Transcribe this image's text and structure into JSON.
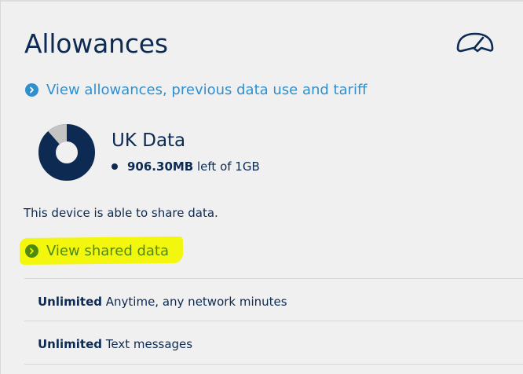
{
  "page": {
    "title": "Allowances",
    "gauge_icon": "speedometer-icon"
  },
  "links": {
    "allowances": "View allowances, previous data use and tariff",
    "shared": "View shared data"
  },
  "data_allowance": {
    "title": "UK Data",
    "remaining_strong": "906.30MB",
    "remaining_rest": " left of 1GB",
    "used_fraction": 0.115,
    "colors": {
      "remaining": "#0c2a52",
      "used": "#c4c4c4"
    }
  },
  "share_note": "This device is able to share data.",
  "allowance_rows": [
    {
      "strong": "Unlimited",
      "text": " Anytime, any network minutes"
    },
    {
      "strong": "Unlimited",
      "text": " Text messages"
    }
  ],
  "colors": {
    "link_blue": "#2f8fcf",
    "link_green": "#4e8a12",
    "highlight": "#f2f500",
    "text_navy": "#0c2a52"
  }
}
